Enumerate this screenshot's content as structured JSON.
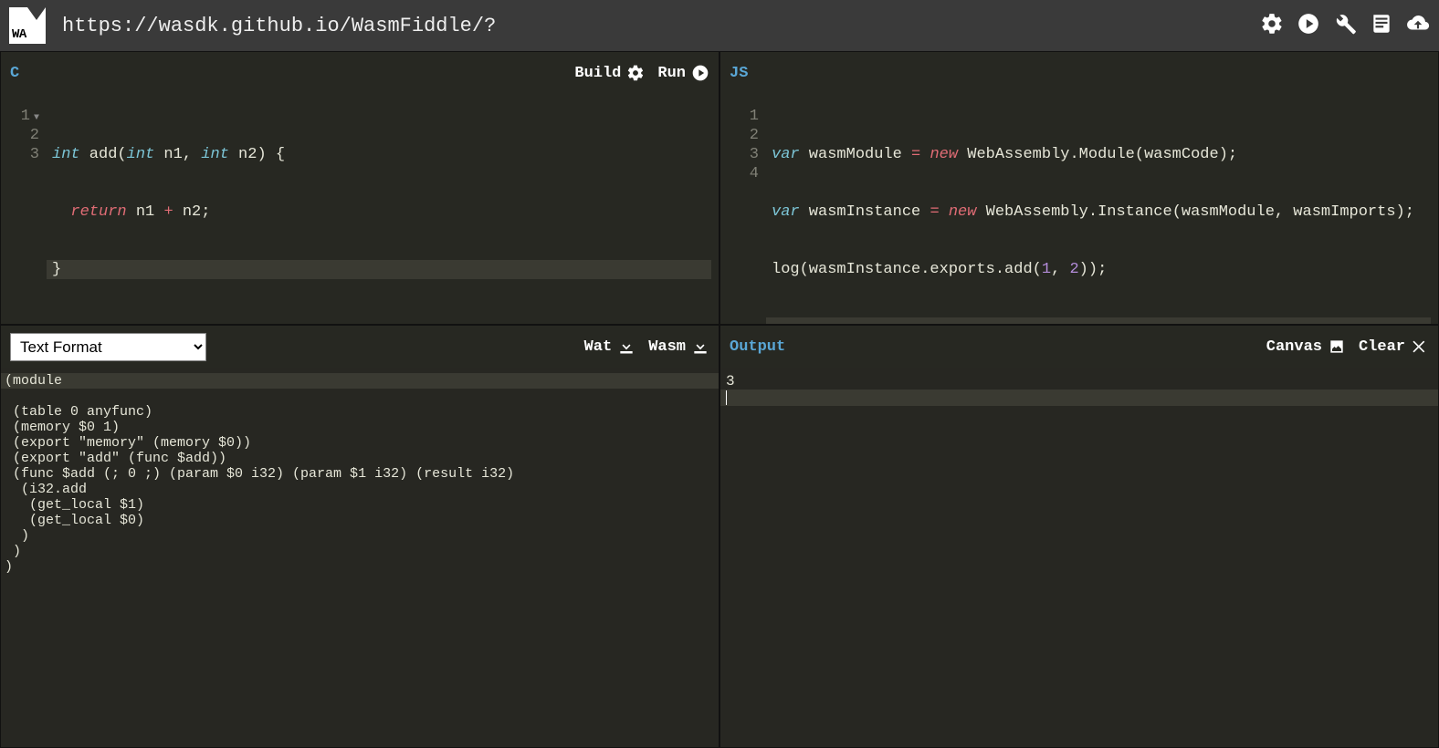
{
  "topbar": {
    "logo_text": "WA",
    "url": "https://wasdk.github.io/WasmFiddle/?"
  },
  "panels": {
    "c": {
      "title": "C",
      "build_label": "Build",
      "run_label": "Run",
      "gutter": [
        "1",
        "2",
        "3"
      ],
      "code": {
        "l1": {
          "t_int": "int",
          "fn": " add",
          "p1": "(",
          "t_int2": "int",
          "n1": " n1",
          "comma": ", ",
          "t_int3": "int",
          "n2": " n2",
          "p2": ") ",
          "brace": "{"
        },
        "l2": {
          "indent": "  ",
          "ret": "return",
          "expr": " n1 ",
          "op": "+",
          "expr2": " n2",
          "semi": ";"
        },
        "l3": {
          "brace": "}"
        }
      }
    },
    "js": {
      "title": "JS",
      "gutter": [
        "1",
        "2",
        "3",
        "4"
      ],
      "code": {
        "l1": {
          "var": "var",
          "s1": " wasmModule ",
          "eq": "=",
          "s2": " ",
          "new": "new",
          "rest": " WebAssembly.Module(wasmCode);"
        },
        "l2": {
          "var": "var",
          "s1": " wasmInstance ",
          "eq": "=",
          "s2": " ",
          "new": "new",
          "rest": " WebAssembly.Instance(wasmModule, wasmImports);"
        },
        "l3": {
          "a": "log(wasmInstance.exports.add(",
          "n1": "1",
          "comma": ", ",
          "n2": "2",
          "b": "));"
        }
      }
    },
    "wat": {
      "select_value": "Text Format",
      "wat_label": "Wat",
      "wasm_label": "Wasm",
      "text": "(module\n (table 0 anyfunc)\n (memory $0 1)\n (export \"memory\" (memory $0))\n (export \"add\" (func $add))\n (func $add (; 0 ;) (param $0 i32) (param $1 i32) (result i32)\n  (i32.add\n   (get_local $1)\n   (get_local $0)\n  )\n )\n)"
    },
    "output": {
      "title": "Output",
      "canvas_label": "Canvas",
      "clear_label": "Clear",
      "text": "3"
    }
  }
}
